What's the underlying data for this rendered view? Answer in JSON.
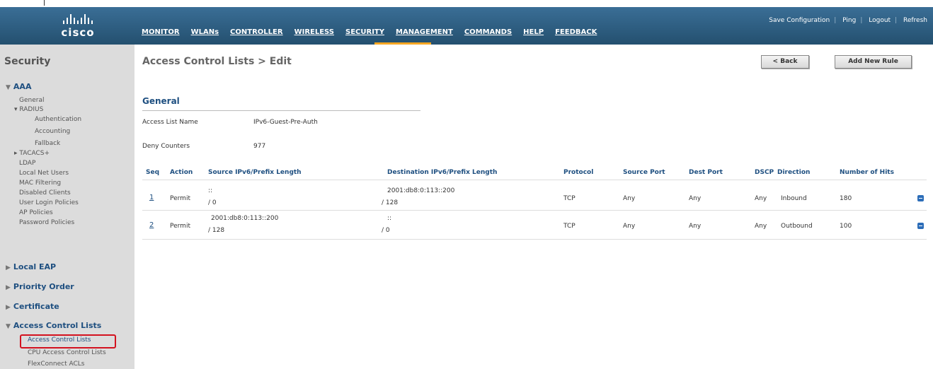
{
  "brand": "cisco",
  "top_links": [
    "Save Configuration",
    "Ping",
    "Logout",
    "Refresh"
  ],
  "nav": [
    "MONITOR",
    "WLANs",
    "CONTROLLER",
    "WIRELESS",
    "SECURITY",
    "MANAGEMENT",
    "COMMANDS",
    "HELP",
    "FEEDBACK"
  ],
  "nav_active": "SECURITY",
  "sidebar": {
    "title": "Security",
    "aaa": "AAA",
    "general": "General",
    "radius": "RADIUS",
    "authentication": "Authentication",
    "accounting": "Accounting",
    "fallback": "Fallback",
    "tacacs": "TACACS+",
    "ldap": "LDAP",
    "local_net_users": "Local Net Users",
    "mac_filtering": "MAC Filtering",
    "disabled_clients": "Disabled Clients",
    "user_login_policies": "User Login Policies",
    "ap_policies": "AP Policies",
    "password_policies": "Password Policies",
    "local_eap": "Local EAP",
    "priority_order": "Priority Order",
    "certificate": "Certificate",
    "access_control_lists": "Access Control Lists",
    "acl_item": "Access Control Lists",
    "cpu_acl": "CPU Access Control Lists",
    "flexconnect": "FlexConnect ACLs"
  },
  "page": {
    "title": "Access Control Lists > Edit",
    "back": "< Back",
    "add_rule": "Add New Rule",
    "general": "General",
    "acl_name_label": "Access List Name",
    "acl_name": "IPv6-Guest-Pre-Auth",
    "deny_label": "Deny Counters",
    "deny_value": "977"
  },
  "table": {
    "headers": [
      "Seq",
      "Action",
      "Source IPv6/Prefix Length",
      "Destination IPv6/Prefix Length",
      "Protocol",
      "Source Port",
      "Dest Port",
      "DSCP",
      "Direction",
      "Number of Hits"
    ],
    "rows": [
      {
        "seq": "1",
        "action": "Permit",
        "src": "::",
        "src_prefix": "/ 0",
        "dst": "2001:db8:0:113::200",
        "dst_prefix": "/ 128",
        "protocol": "TCP",
        "sport": "Any",
        "dport": "Any",
        "dscp": "Any",
        "direction": "Inbound",
        "hits": "180"
      },
      {
        "seq": "2",
        "action": "Permit",
        "src": "2001:db8:0:113::200",
        "src_prefix": "/ 128",
        "dst": "::",
        "dst_prefix": "/ 0",
        "protocol": "TCP",
        "sport": "Any",
        "dport": "Any",
        "dscp": "Any",
        "direction": "Outbound",
        "hits": "100"
      }
    ]
  },
  "colors": {
    "header": "#2f6187",
    "accent": "#f5a623",
    "link": "#1e4f80",
    "highlight": "#d3121f"
  }
}
